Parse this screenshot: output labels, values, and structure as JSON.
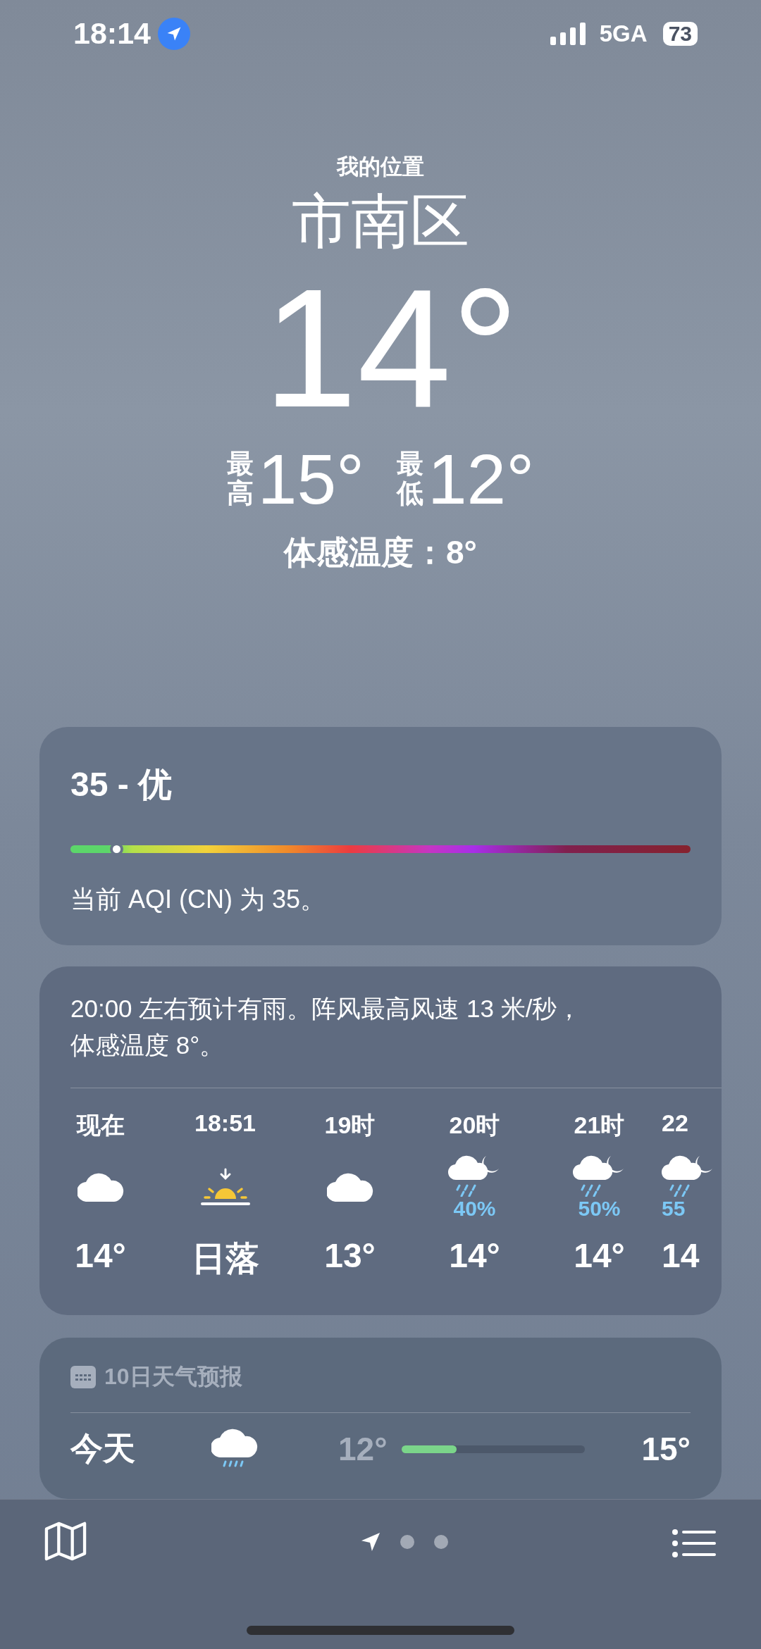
{
  "status_bar": {
    "time": "18:14",
    "network": "5GA",
    "battery": "73"
  },
  "location": {
    "label": "我的位置",
    "city": "市南区",
    "temperature": "14°",
    "high_label": "最高",
    "high": "15°",
    "low_label": "最低",
    "low": "12°",
    "feels_like": "体感温度：8°"
  },
  "aqi": {
    "title": "35 - 优",
    "level": 0.074,
    "description": "当前 AQI (CN) 为 35。"
  },
  "hourly": {
    "summary": "20:00 左右预计有雨。阵风最高风速 13 米/秒，体感温度 8°。",
    "hours": [
      {
        "label": "现在",
        "kind": "cloud",
        "temp": "14°"
      },
      {
        "label": "18:51",
        "kind": "sunset",
        "temp": "日落"
      },
      {
        "label": "19时",
        "kind": "cloud",
        "temp": "13°"
      },
      {
        "label": "20时",
        "kind": "rain-night",
        "precip": "40%",
        "temp": "14°"
      },
      {
        "label": "21时",
        "kind": "rain-night",
        "precip": "50%",
        "temp": "14°"
      },
      {
        "label": "22",
        "kind": "rain-night",
        "precip": "55",
        "temp": "14"
      }
    ]
  },
  "forecast": {
    "title": "10日天气预报",
    "days": [
      {
        "day": "今天",
        "kind": "rain",
        "low": "12°",
        "level": 0.3,
        "high": "15°"
      }
    ]
  },
  "tab_bar": {
    "pages": [
      {
        "kind": "location",
        "selected": true
      },
      {
        "kind": "city",
        "selected": false
      },
      {
        "kind": "city",
        "selected": false
      }
    ]
  }
}
